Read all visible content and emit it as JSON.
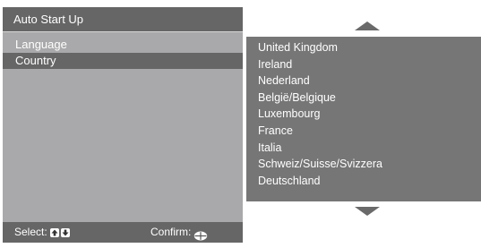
{
  "window": {
    "title": "Auto Start Up"
  },
  "menu": {
    "items": [
      {
        "label": "Language",
        "selected": false
      },
      {
        "label": "Country",
        "selected": true
      }
    ]
  },
  "country_list": {
    "items": [
      "United Kingdom",
      "Ireland",
      "Nederland",
      "België/Belgique",
      "Luxembourg",
      "France",
      "Italia",
      "Schweiz/Suisse/Svizzera",
      "Deutschland"
    ],
    "scroll_up_icon": "triangle-up-icon",
    "scroll_down_icon": "triangle-down-icon"
  },
  "footer": {
    "select_label": "Select:",
    "select_icons": [
      "up-arrow-key-icon",
      "down-arrow-key-icon"
    ],
    "confirm_label": "Confirm:",
    "confirm_icon": "enter-key-icon"
  },
  "colors": {
    "title_bar": "#666666",
    "panel": "#a9a9ab",
    "list_bg": "#767677",
    "selected_item": "#666666",
    "text": "#ffffff",
    "arrow": "#6a6a6a"
  }
}
